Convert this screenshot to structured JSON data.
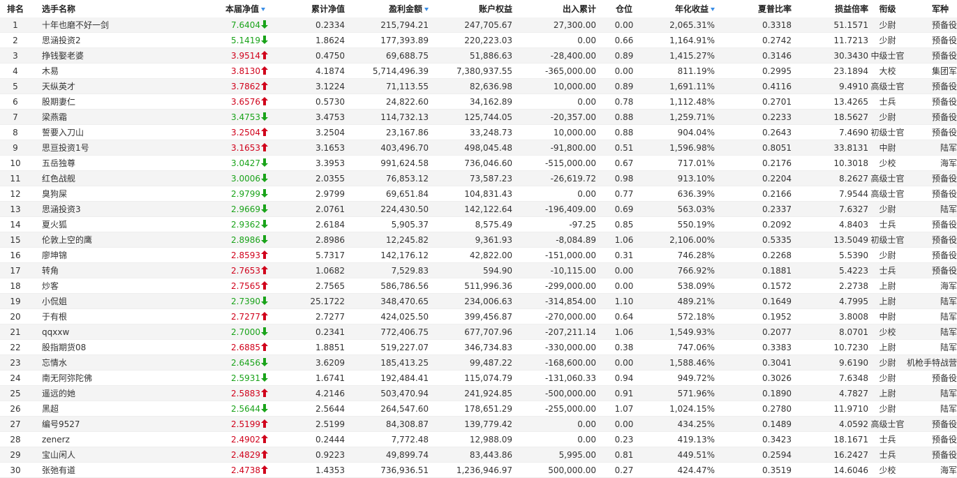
{
  "colors": {
    "up": "#d0021b",
    "down": "#1aa31a",
    "sort": "#3a8ee6"
  },
  "headers": {
    "rank": "排名",
    "name": "选手名称",
    "nav": "本届净值",
    "cum_nav": "累计净值",
    "profit": "盈利金额",
    "equity": "账户权益",
    "inout": "出入累计",
    "position": "仓位",
    "annual": "年化收益",
    "sharpe": "夏普比率",
    "pl_ratio": "损益倍率",
    "rank_title": "衔级",
    "army": "军种"
  },
  "rows": [
    {
      "rank": "1",
      "name": "十年也磨不好一剑",
      "nav": "7.6404",
      "dir": "down",
      "cum_nav": "0.2334",
      "profit": "215,794.21",
      "equity": "247,705.67",
      "inout": "27,300.00",
      "position": "0.00",
      "annual": "2,065.31%",
      "sharpe": "0.3318",
      "pl_ratio": "51.1571",
      "rank_title": "少尉",
      "army": "预备役"
    },
    {
      "rank": "2",
      "name": "思涵投资2",
      "nav": "5.1419",
      "dir": "down",
      "cum_nav": "1.8624",
      "profit": "177,393.89",
      "equity": "220,223.03",
      "inout": "0.00",
      "position": "0.66",
      "annual": "1,164.91%",
      "sharpe": "0.2742",
      "pl_ratio": "11.7213",
      "rank_title": "少尉",
      "army": "预备役"
    },
    {
      "rank": "3",
      "name": "挣钱娶老婆",
      "nav": "3.9514",
      "dir": "up",
      "cum_nav": "0.4750",
      "profit": "69,688.75",
      "equity": "51,886.63",
      "inout": "-28,400.00",
      "position": "0.89",
      "annual": "1,415.27%",
      "sharpe": "0.3146",
      "pl_ratio": "30.3430",
      "rank_title": "中级士官",
      "army": "预备役"
    },
    {
      "rank": "4",
      "name": "木易",
      "nav": "3.8130",
      "dir": "up",
      "cum_nav": "4.1874",
      "profit": "5,714,496.39",
      "equity": "7,380,937.55",
      "inout": "-365,000.00",
      "position": "0.00",
      "annual": "811.19%",
      "sharpe": "0.2995",
      "pl_ratio": "23.1894",
      "rank_title": "大校",
      "army": "集团军"
    },
    {
      "rank": "5",
      "name": "天纵英才",
      "nav": "3.7862",
      "dir": "up",
      "cum_nav": "3.1224",
      "profit": "71,113.55",
      "equity": "82,636.98",
      "inout": "10,000.00",
      "position": "0.89",
      "annual": "1,691.11%",
      "sharpe": "0.4116",
      "pl_ratio": "9.4910",
      "rank_title": "高级士官",
      "army": "预备役"
    },
    {
      "rank": "6",
      "name": "股期妻仁",
      "nav": "3.6576",
      "dir": "up",
      "cum_nav": "0.5730",
      "profit": "24,822.60",
      "equity": "34,162.89",
      "inout": "0.00",
      "position": "0.78",
      "annual": "1,112.48%",
      "sharpe": "0.2701",
      "pl_ratio": "13.4265",
      "rank_title": "士兵",
      "army": "预备役"
    },
    {
      "rank": "7",
      "name": "梁燕霜",
      "nav": "3.4753",
      "dir": "down",
      "cum_nav": "3.4753",
      "profit": "114,732.13",
      "equity": "125,744.05",
      "inout": "-20,357.00",
      "position": "0.88",
      "annual": "1,259.71%",
      "sharpe": "0.2233",
      "pl_ratio": "18.5627",
      "rank_title": "少尉",
      "army": "预备役"
    },
    {
      "rank": "8",
      "name": "誓要入刀山",
      "nav": "3.2504",
      "dir": "up",
      "cum_nav": "3.2504",
      "profit": "23,167.86",
      "equity": "33,248.73",
      "inout": "10,000.00",
      "position": "0.88",
      "annual": "904.04%",
      "sharpe": "0.2643",
      "pl_ratio": "7.4690",
      "rank_title": "初级士官",
      "army": "预备役"
    },
    {
      "rank": "9",
      "name": "思亘投资1号",
      "nav": "3.1653",
      "dir": "up",
      "cum_nav": "3.1653",
      "profit": "403,496.70",
      "equity": "498,045.48",
      "inout": "-91,800.00",
      "position": "0.51",
      "annual": "1,596.98%",
      "sharpe": "0.8051",
      "pl_ratio": "33.8131",
      "rank_title": "中尉",
      "army": "陆军"
    },
    {
      "rank": "10",
      "name": "五岳独尊",
      "nav": "3.0427",
      "dir": "down",
      "cum_nav": "3.3953",
      "profit": "991,624.58",
      "equity": "736,046.60",
      "inout": "-515,000.00",
      "position": "0.67",
      "annual": "717.01%",
      "sharpe": "0.2176",
      "pl_ratio": "10.3018",
      "rank_title": "少校",
      "army": "海军"
    },
    {
      "rank": "11",
      "name": "红色战舰",
      "nav": "3.0006",
      "dir": "down",
      "cum_nav": "2.0355",
      "profit": "76,853.12",
      "equity": "73,587.23",
      "inout": "-26,619.72",
      "position": "0.98",
      "annual": "913.10%",
      "sharpe": "0.2204",
      "pl_ratio": "8.2627",
      "rank_title": "高级士官",
      "army": "预备役"
    },
    {
      "rank": "12",
      "name": "臭狗屎",
      "nav": "2.9799",
      "dir": "down",
      "cum_nav": "2.9799",
      "profit": "69,651.84",
      "equity": "104,831.43",
      "inout": "0.00",
      "position": "0.77",
      "annual": "636.39%",
      "sharpe": "0.2166",
      "pl_ratio": "7.9544",
      "rank_title": "高级士官",
      "army": "预备役"
    },
    {
      "rank": "13",
      "name": "思涵投资3",
      "nav": "2.9669",
      "dir": "down",
      "cum_nav": "2.0761",
      "profit": "224,430.50",
      "equity": "142,122.64",
      "inout": "-196,409.00",
      "position": "0.69",
      "annual": "563.03%",
      "sharpe": "0.2337",
      "pl_ratio": "7.6327",
      "rank_title": "少尉",
      "army": "陆军"
    },
    {
      "rank": "14",
      "name": "夏火狐",
      "nav": "2.9362",
      "dir": "down",
      "cum_nav": "2.6184",
      "profit": "5,905.37",
      "equity": "8,575.49",
      "inout": "-97.25",
      "position": "0.85",
      "annual": "550.19%",
      "sharpe": "0.2092",
      "pl_ratio": "4.8403",
      "rank_title": "士兵",
      "army": "预备役"
    },
    {
      "rank": "15",
      "name": "伦敦上空的鹰",
      "nav": "2.8986",
      "dir": "down",
      "cum_nav": "2.8986",
      "profit": "12,245.82",
      "equity": "9,361.93",
      "inout": "-8,084.89",
      "position": "1.06",
      "annual": "2,106.00%",
      "sharpe": "0.5335",
      "pl_ratio": "13.5049",
      "rank_title": "初级士官",
      "army": "预备役"
    },
    {
      "rank": "16",
      "name": "廖坤锦",
      "nav": "2.8593",
      "dir": "up",
      "cum_nav": "5.7317",
      "profit": "142,176.12",
      "equity": "42,822.00",
      "inout": "-151,000.00",
      "position": "0.31",
      "annual": "746.28%",
      "sharpe": "0.2268",
      "pl_ratio": "5.5390",
      "rank_title": "少尉",
      "army": "预备役"
    },
    {
      "rank": "17",
      "name": "转角",
      "nav": "2.7653",
      "dir": "up",
      "cum_nav": "1.0682",
      "profit": "7,529.83",
      "equity": "594.90",
      "inout": "-10,115.00",
      "position": "0.00",
      "annual": "766.92%",
      "sharpe": "0.1881",
      "pl_ratio": "5.4223",
      "rank_title": "士兵",
      "army": "预备役"
    },
    {
      "rank": "18",
      "name": "炒客",
      "nav": "2.7565",
      "dir": "up",
      "cum_nav": "2.7565",
      "profit": "586,786.56",
      "equity": "511,996.36",
      "inout": "-299,000.00",
      "position": "0.00",
      "annual": "538.09%",
      "sharpe": "0.1572",
      "pl_ratio": "2.2738",
      "rank_title": "上尉",
      "army": "海军"
    },
    {
      "rank": "19",
      "name": "小侃姐",
      "nav": "2.7390",
      "dir": "down",
      "cum_nav": "25.1722",
      "profit": "348,470.65",
      "equity": "234,006.63",
      "inout": "-314,854.00",
      "position": "1.10",
      "annual": "489.21%",
      "sharpe": "0.1649",
      "pl_ratio": "4.7995",
      "rank_title": "上尉",
      "army": "陆军"
    },
    {
      "rank": "20",
      "name": "于有根",
      "nav": "2.7277",
      "dir": "up",
      "cum_nav": "2.7277",
      "profit": "424,025.50",
      "equity": "399,456.87",
      "inout": "-270,000.00",
      "position": "0.64",
      "annual": "572.18%",
      "sharpe": "0.1952",
      "pl_ratio": "3.8008",
      "rank_title": "中尉",
      "army": "陆军"
    },
    {
      "rank": "21",
      "name": "qqxxw",
      "nav": "2.7000",
      "dir": "down",
      "cum_nav": "0.2341",
      "profit": "772,406.75",
      "equity": "677,707.96",
      "inout": "-207,211.14",
      "position": "1.06",
      "annual": "1,549.93%",
      "sharpe": "0.2077",
      "pl_ratio": "8.0701",
      "rank_title": "少校",
      "army": "陆军"
    },
    {
      "rank": "22",
      "name": "股指期货08",
      "nav": "2.6885",
      "dir": "up",
      "cum_nav": "1.8851",
      "profit": "519,227.07",
      "equity": "346,734.83",
      "inout": "-330,000.00",
      "position": "0.38",
      "annual": "747.06%",
      "sharpe": "0.3383",
      "pl_ratio": "10.7230",
      "rank_title": "上尉",
      "army": "陆军"
    },
    {
      "rank": "23",
      "name": "忘情水",
      "nav": "2.6456",
      "dir": "down",
      "cum_nav": "3.6209",
      "profit": "185,413.25",
      "equity": "99,487.22",
      "inout": "-168,600.00",
      "position": "0.00",
      "annual": "1,588.46%",
      "sharpe": "0.3041",
      "pl_ratio": "9.6190",
      "rank_title": "少尉",
      "army": "机枪手特战营"
    },
    {
      "rank": "24",
      "name": "南无阿弥陀佛",
      "nav": "2.5931",
      "dir": "down",
      "cum_nav": "1.6741",
      "profit": "192,484.41",
      "equity": "115,074.79",
      "inout": "-131,060.33",
      "position": "0.94",
      "annual": "949.72%",
      "sharpe": "0.3026",
      "pl_ratio": "7.6348",
      "rank_title": "少尉",
      "army": "预备役"
    },
    {
      "rank": "25",
      "name": "遥远的她",
      "nav": "2.5883",
      "dir": "up",
      "cum_nav": "4.2146",
      "profit": "503,470.94",
      "equity": "241,924.85",
      "inout": "-500,000.00",
      "position": "0.91",
      "annual": "571.96%",
      "sharpe": "0.1890",
      "pl_ratio": "4.7827",
      "rank_title": "上尉",
      "army": "陆军"
    },
    {
      "rank": "26",
      "name": "黑超",
      "nav": "2.5644",
      "dir": "down",
      "cum_nav": "2.5644",
      "profit": "264,547.60",
      "equity": "178,651.29",
      "inout": "-255,000.00",
      "position": "1.07",
      "annual": "1,024.15%",
      "sharpe": "0.2780",
      "pl_ratio": "11.9710",
      "rank_title": "少尉",
      "army": "陆军"
    },
    {
      "rank": "27",
      "name": "编号9527",
      "nav": "2.5199",
      "dir": "up",
      "cum_nav": "2.5199",
      "profit": "84,308.87",
      "equity": "139,779.42",
      "inout": "0.00",
      "position": "0.00",
      "annual": "434.25%",
      "sharpe": "0.1489",
      "pl_ratio": "4.0592",
      "rank_title": "高级士官",
      "army": "预备役"
    },
    {
      "rank": "28",
      "name": "zenerz",
      "nav": "2.4902",
      "dir": "up",
      "cum_nav": "0.2444",
      "profit": "7,772.48",
      "equity": "12,988.09",
      "inout": "0.00",
      "position": "0.23",
      "annual": "419.13%",
      "sharpe": "0.3423",
      "pl_ratio": "18.1671",
      "rank_title": "士兵",
      "army": "预备役"
    },
    {
      "rank": "29",
      "name": "宝山闲人",
      "nav": "2.4829",
      "dir": "up",
      "cum_nav": "0.9223",
      "profit": "49,899.74",
      "equity": "83,443.86",
      "inout": "5,995.00",
      "position": "0.81",
      "annual": "449.51%",
      "sharpe": "0.2594",
      "pl_ratio": "16.2427",
      "rank_title": "士兵",
      "army": "预备役"
    },
    {
      "rank": "30",
      "name": "张弛有道",
      "nav": "2.4738",
      "dir": "up",
      "cum_nav": "1.4353",
      "profit": "736,936.51",
      "equity": "1,236,946.97",
      "inout": "500,000.00",
      "position": "0.27",
      "annual": "424.47%",
      "sharpe": "0.3519",
      "pl_ratio": "14.6046",
      "rank_title": "少校",
      "army": "海军"
    }
  ]
}
